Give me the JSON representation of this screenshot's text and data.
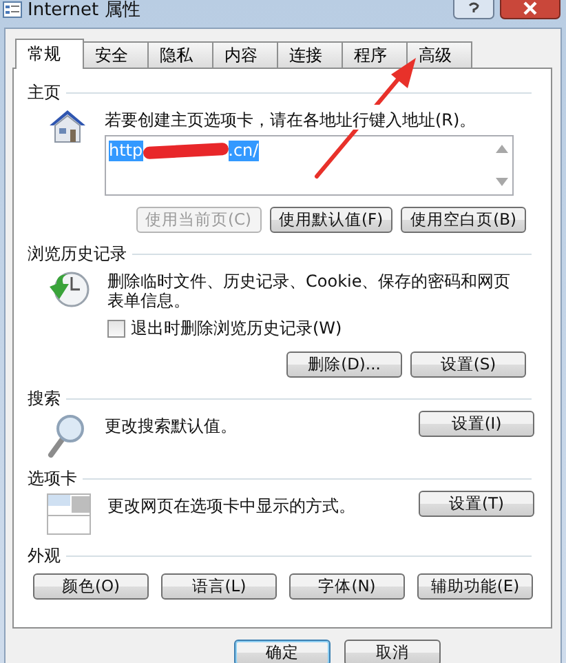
{
  "window": {
    "title": "Internet 属性"
  },
  "tabs": [
    {
      "label": "常规",
      "selected": true
    },
    {
      "label": "安全",
      "selected": false
    },
    {
      "label": "隐私",
      "selected": false
    },
    {
      "label": "内容",
      "selected": false
    },
    {
      "label": "连接",
      "selected": false
    },
    {
      "label": "程序",
      "selected": false
    },
    {
      "label": "高级",
      "selected": false
    }
  ],
  "home_page": {
    "heading": "主页",
    "description": "若要创建主页选项卡，请在各地址行键入地址(R)。",
    "url_start": "http",
    "url_end": ".cn/",
    "redacted": true,
    "buttons": [
      {
        "label": "使用当前页(C)",
        "disabled": true
      },
      {
        "label": "使用默认值(F)",
        "disabled": false
      },
      {
        "label": "使用空白页(B)",
        "disabled": false
      }
    ]
  },
  "browsing_history": {
    "heading": "浏览历史记录",
    "description": "删除临时文件、历史记录、Cookie、保存的密码和网页表单信息。",
    "checkbox": {
      "label": "退出时删除浏览历史记录(W)",
      "checked": false
    },
    "buttons": [
      {
        "label": "删除(D)...",
        "disabled": false
      },
      {
        "label": "设置(S)",
        "disabled": false
      }
    ]
  },
  "search": {
    "heading": "搜索",
    "description": "更改搜索默认值。",
    "button": "设置(I)"
  },
  "tabs_section": {
    "heading": "选项卡",
    "description": "更改网页在选项卡中显示的方式。",
    "button": "设置(T)"
  },
  "appearance": {
    "heading": "外观",
    "buttons": [
      "颜色(O)",
      "语言(L)",
      "字体(N)",
      "辅助功能(E)"
    ]
  },
  "dialog_buttons": [
    {
      "label": "确定",
      "default": true
    },
    {
      "label": "取消",
      "default": false
    }
  ],
  "annotation": {
    "kind": "arrow"
  }
}
